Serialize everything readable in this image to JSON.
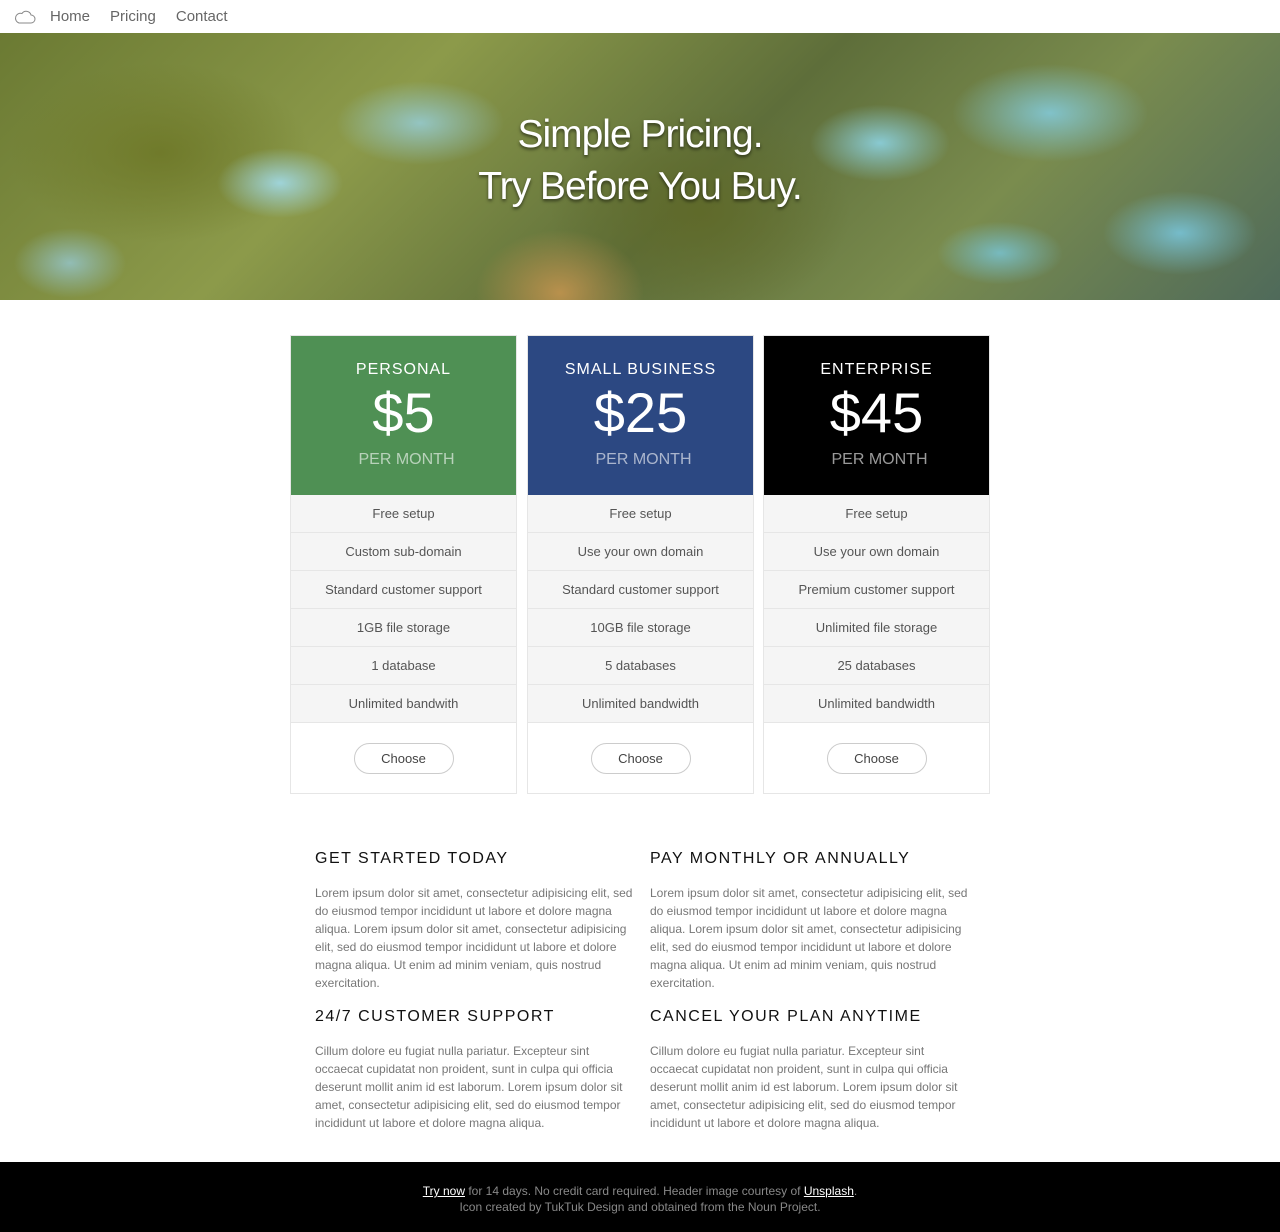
{
  "nav": {
    "logo_icon": "cloud-icon",
    "items": [
      "Home",
      "Pricing",
      "Contact"
    ]
  },
  "hero": {
    "line1": "Simple Pricing.",
    "line2": "Try Before You Buy."
  },
  "plans": [
    {
      "name": "Personal",
      "price": "$5",
      "period": "per month",
      "color": "#4f9054",
      "features": [
        "Free setup",
        "Custom sub-domain",
        "Standard customer support",
        "1GB file storage",
        "1 database",
        "Unlimited bandwith"
      ],
      "button": "Choose"
    },
    {
      "name": "Small Business",
      "price": "$25",
      "period": "per month",
      "color": "#2c4882",
      "features": [
        "Free setup",
        "Use your own domain",
        "Standard customer support",
        "10GB file storage",
        "5 databases",
        "Unlimited bandwidth"
      ],
      "button": "Choose"
    },
    {
      "name": "Enterprise",
      "price": "$45",
      "period": "per month",
      "color": "#000000",
      "features": [
        "Free setup",
        "Use your own domain",
        "Premium customer support",
        "Unlimited file storage",
        "25 databases",
        "Unlimited bandwidth"
      ],
      "button": "Choose"
    }
  ],
  "info": [
    {
      "title": "Get started today",
      "text": "Lorem ipsum dolor sit amet, consectetur adipisicing elit, sed do eiusmod tempor incididunt ut labore et dolore magna aliqua. Lorem ipsum dolor sit amet, consectetur adipisicing elit, sed do eiusmod tempor incididunt ut labore et dolore magna aliqua. Ut enim ad minim veniam, quis nostrud exercitation."
    },
    {
      "title": "Pay monthly or annually",
      "text": "Lorem ipsum dolor sit amet, consectetur adipisicing elit, sed do eiusmod tempor incididunt ut labore et dolore magna aliqua. Lorem ipsum dolor sit amet, consectetur adipisicing elit, sed do eiusmod tempor incididunt ut labore et dolore magna aliqua. Ut enim ad minim veniam, quis nostrud exercitation."
    },
    {
      "title": "24/7 customer support",
      "text": "Cillum dolore eu fugiat nulla pariatur. Excepteur sint occaecat cupidatat non proident, sunt in culpa qui officia deserunt mollit anim id est laborum. Lorem ipsum dolor sit amet, consectetur adipisicing elit, sed do eiusmod tempor incididunt ut labore et dolore magna aliqua."
    },
    {
      "title": "Cancel your plan anytime",
      "text": "Cillum dolore eu fugiat nulla pariatur. Excepteur sint occaecat cupidatat non proident, sunt in culpa qui officia deserunt mollit anim id est laborum. Lorem ipsum dolor sit amet, consectetur adipisicing elit, sed do eiusmod tempor incididunt ut labore et dolore magna aliqua."
    }
  ],
  "footer": {
    "try_link": "Try now",
    "text1": " for 14 days. No credit card required. Header image courtesy of ",
    "unsplash_link": "Unsplash",
    "text2": ".",
    "line2": "Icon created by TukTuk Design and obtained from the Noun Project."
  }
}
